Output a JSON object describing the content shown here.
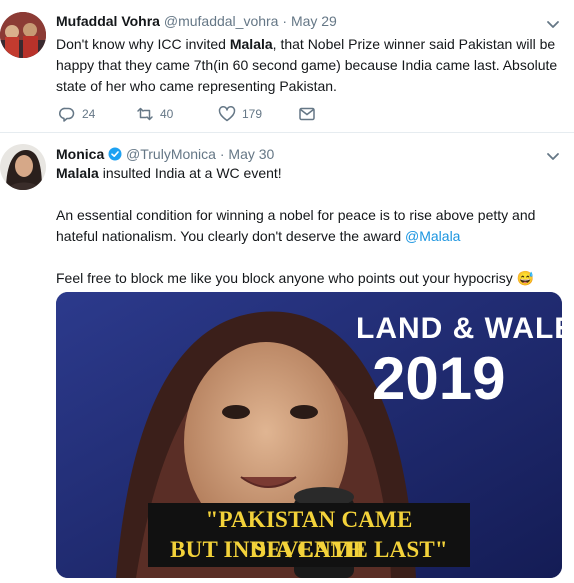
{
  "tweets": [
    {
      "name": "Mufaddal Vohra",
      "handle": "@mufaddal_vohra",
      "sep": "·",
      "date": "May 29",
      "lines": [
        [
          "Don't know why ICC invited ",
          "Malala",
          ", that Nobel Prize winner said Pakistan will be"
        ],
        [
          "happy that they came 7th(in 60 second game) because India came last. Absolute"
        ],
        [
          "state of her who came representing Pakistan."
        ]
      ],
      "replies": "24",
      "retweets": "40",
      "likes": "179",
      "icons": {
        "reply": "reply-icon",
        "retweet": "retweet-icon",
        "like": "heart-icon",
        "dm": "envelope-icon",
        "menu": "chevron-down-icon"
      }
    },
    {
      "name": "Monica",
      "verified": "verified-badge-icon",
      "handle": "@TrulyMonica",
      "sep": "·",
      "date": "May 30",
      "line1_bold": "Malala",
      "line1_rest": " insulted India at a WC event!",
      "para2_line1": "An essential condition for winning a nobel for peace is to rise above petty and",
      "para2_line2_pre": "hateful nationalism. You clearly don't deserve the award ",
      "mention": "@Malala",
      "para3": "Feel free to block me like you block anyone who points out your hypocrisy",
      "emoji": "😅",
      "media": {
        "banner_line1": "LAND & WALE",
        "banner_year": "2019",
        "caption_line1": "\"PAKISTAN CAME SEVENTH",
        "caption_line2": "BUT INDIA CAME LAST\""
      }
    }
  ],
  "colors": {
    "link": "#1b95e0",
    "secondary": "#657786",
    "text": "#14171a",
    "verified": "#1da1f2",
    "caption": "#f3d23a"
  }
}
